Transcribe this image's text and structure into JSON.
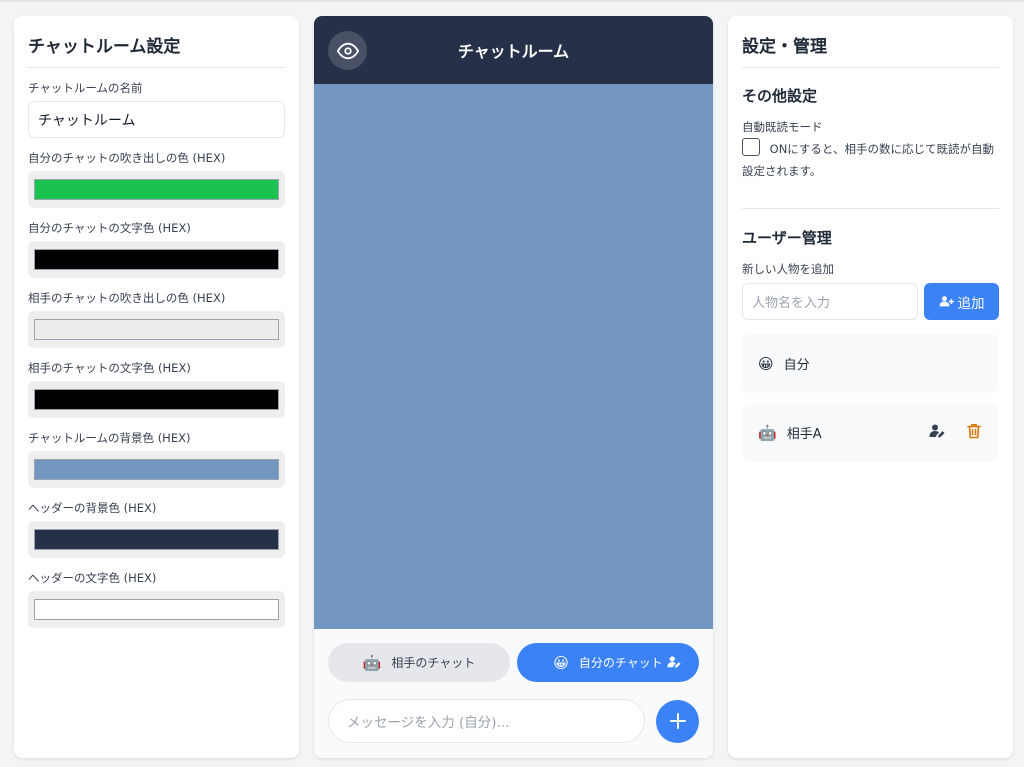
{
  "left": {
    "title": "チャットルーム設定",
    "name_label": "チャットルームの名前",
    "name_value": "チャットルーム",
    "fields": [
      {
        "label": "自分のチャットの吹き出しの色 (HEX)",
        "color": "#1ac250"
      },
      {
        "label": "自分のチャットの文字色 (HEX)",
        "color": "#000000"
      },
      {
        "label": "相手のチャットの吹き出しの色 (HEX)",
        "color": "#ececec"
      },
      {
        "label": "相手のチャットの文字色 (HEX)",
        "color": "#000000"
      },
      {
        "label": "チャットルームの背景色 (HEX)",
        "color": "#7497c1"
      },
      {
        "label": "ヘッダーの背景色 (HEX)",
        "color": "#263048"
      },
      {
        "label": "ヘッダーの文字色 (HEX)",
        "color": "#ffffff"
      }
    ]
  },
  "chat": {
    "title": "チャットルーム",
    "header_bg": "#263048",
    "header_fg": "#ffffff",
    "body_bg": "#7497c1",
    "other_button": "相手のチャット",
    "self_button": "自分のチャット",
    "other_emoji": "🤖",
    "self_emoji": "😀",
    "message_placeholder": "メッセージを入力 (自分)..."
  },
  "right": {
    "title": "設定・管理",
    "other_settings": "その他設定",
    "auto_read_label": "自動既読モード",
    "auto_read_desc": "ONにすると、相手の数に応じて既読が自動設定されます。",
    "user_mgmt": "ユーザー管理",
    "add_person_label": "新しい人物を追加",
    "person_placeholder": "人物名を入力",
    "add_button": "追加",
    "users": [
      {
        "emoji": "😀",
        "name": "自分"
      },
      {
        "emoji": "🤖",
        "name": "相手A"
      }
    ]
  },
  "colors": {
    "accent": "#3b82f6",
    "danger": "#d97706"
  }
}
